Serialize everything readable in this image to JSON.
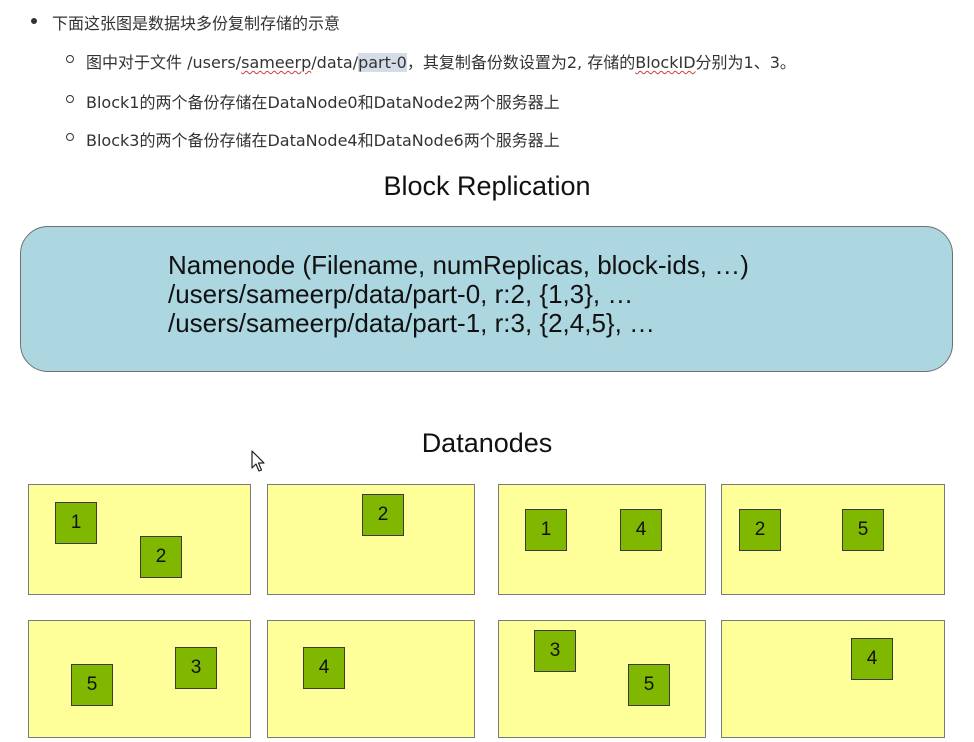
{
  "bullets": {
    "main": "下面这张图是数据块多份复制存储的示意",
    "sub1": {
      "pre": "图中对于文件 /users/",
      "user": "sameerp",
      "mid": "/data/",
      "file": "part-0",
      "post": "，其复制备份数设置为2, 存储的",
      "blockid": "BlockID",
      "tail": "分别为1、3。"
    },
    "sub2": "Block1的两个备份存储在DataNode0和DataNode2两个服务器上",
    "sub3": "Block3的两个备份存储在DataNode4和DataNode6两个服务器上"
  },
  "diagram": {
    "title": "Block Replication",
    "namenode_lines": [
      "Namenode (Filename, numReplicas, block-ids, …)",
      "/users/sameerp/data/part-0, r:2, {1,3}, …",
      "/users/sameerp/data/part-1, r:3, {2,4,5}, …"
    ],
    "datanodes_title": "Datanodes",
    "datanodes": [
      {
        "blocks": [
          "1",
          "2"
        ]
      },
      {
        "blocks": [
          "2"
        ]
      },
      {
        "blocks": [
          "1",
          "4"
        ]
      },
      {
        "blocks": [
          "2",
          "5"
        ]
      },
      {
        "blocks": [
          "5",
          "3"
        ]
      },
      {
        "blocks": [
          "4"
        ]
      },
      {
        "blocks": [
          "3",
          "5"
        ]
      },
      {
        "blocks": [
          "4"
        ]
      }
    ]
  },
  "colors": {
    "namenode_fill": "#acd6e0",
    "datanode_fill": "#ffff99",
    "block_fill": "#80b700"
  },
  "icons": {
    "cursor": "mouse-pointer-icon"
  }
}
